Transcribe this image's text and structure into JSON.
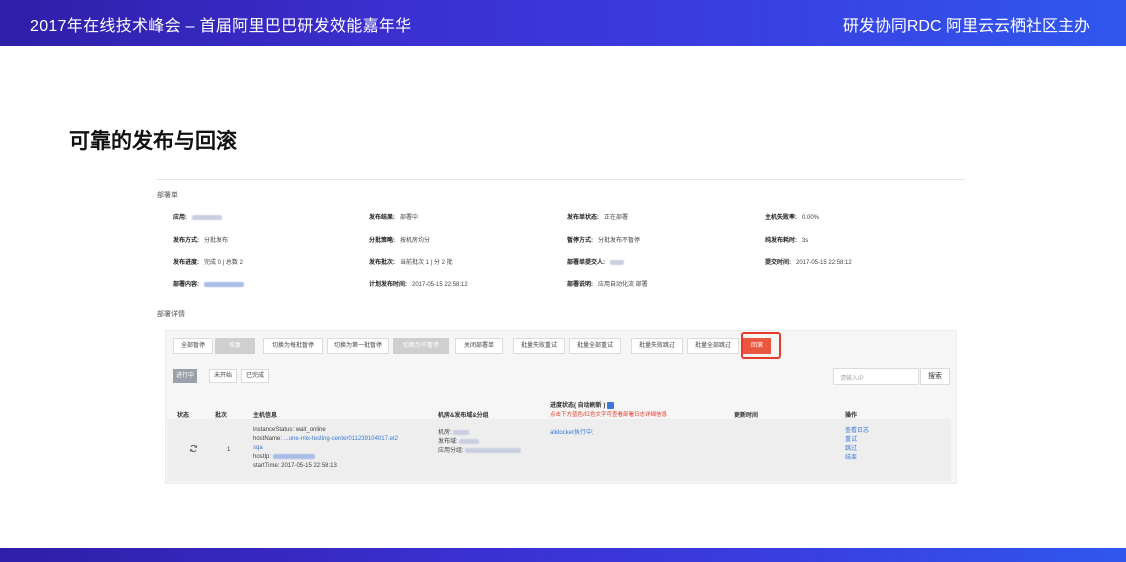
{
  "slide": {
    "header_left": "2017年在线技术峰会 – 首届阿里巴巴研发效能嘉年华",
    "header_right": "研发协同RDC 阿里云云栖社区主办",
    "heading": "可靠的发布与回滚"
  },
  "deploy_order": {
    "section_title": "部署单",
    "rows": [
      [
        {
          "label": "应用:",
          "value": ""
        },
        {
          "label": "发布结果:",
          "value": "部署中"
        },
        {
          "label": "发布单状态:",
          "value": "正在部署"
        },
        {
          "label": "主机失败率:",
          "value": "0.00%"
        }
      ],
      [
        {
          "label": "发布方式:",
          "value": "分批发布"
        },
        {
          "label": "分批策略:",
          "value": "按机房均分"
        },
        {
          "label": "暂停方式:",
          "value": "分批发布不暂停"
        },
        {
          "label": "纯发布耗时:",
          "value": "3s"
        }
      ],
      [
        {
          "label": "发布进度:",
          "value": "完成 0 | 总数 2"
        },
        {
          "label": "发布批次:",
          "value": "当前批次 1 | 分 2 批"
        },
        {
          "label": "部署单提交人:",
          "value": ""
        },
        {
          "label": "提交时间:",
          "value": "2017-05-15 22:58:12"
        }
      ],
      [
        {
          "label": "部署内容:",
          "value": ""
        },
        {
          "label": "计划发布时间:",
          "value": "2017-05-15 22:58:12"
        },
        {
          "label": "部署说明:",
          "value": "应用自动化流 部署"
        },
        {
          "label": "",
          "value": ""
        }
      ]
    ]
  },
  "detail": {
    "section_title": "部署详情",
    "toolbar": [
      "全部暂停",
      "恢复",
      "切换为每批暂停",
      "切换为第一批暂停",
      "切换为不暂停",
      "关闭部署单",
      "批量失败重试",
      "批量全部重试",
      "批量失败跳过",
      "批量全部跳过",
      "回滚"
    ],
    "tabs": [
      "进行中",
      "未开始",
      "已完成"
    ],
    "search_placeholder": "请输入IP",
    "search_button": "搜索",
    "columns": [
      "状态",
      "批次",
      "主机信息",
      "机房&发布域&分组",
      "进度状态( 自动刷新 )",
      "更新时间",
      "操作"
    ],
    "progress_tip": "点击下方蓝色/红色文字可查看部署日志详细信息",
    "row": {
      "batch": "1",
      "host_lines": [
        "instanceStatus:  wait_online",
        "hostName:  ",
        "sqa",
        "hostIp:  ",
        "startTime:  2017-05-15 22:58:13"
      ],
      "host_name_value": "...one-mix-testing-center011239104017.et2",
      "room_lines": [
        "机房: ",
        "发布域: ",
        "应用分组: "
      ],
      "progress": "alidocker执行中;",
      "actions": [
        "查看日志",
        "重试",
        "跳过",
        "结束"
      ]
    }
  }
}
